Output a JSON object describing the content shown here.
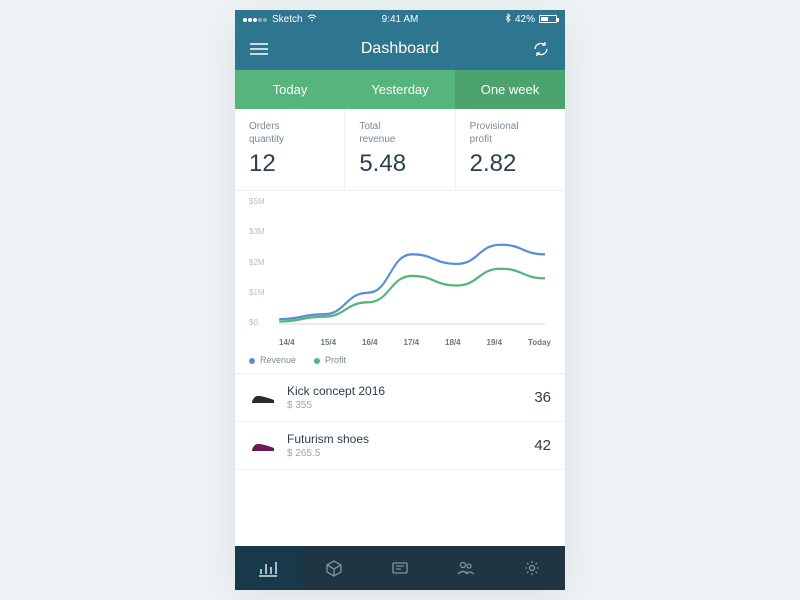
{
  "statusbar": {
    "carrier": "Sketch",
    "time": "9:41 AM",
    "battery_pct": "42%"
  },
  "header": {
    "title": "Dashboard"
  },
  "tabs": [
    {
      "label": "Today",
      "active": false
    },
    {
      "label": "Yesterday",
      "active": false
    },
    {
      "label": "One week",
      "active": true
    }
  ],
  "stats": [
    {
      "label": "Orders\nquantity",
      "value": "12"
    },
    {
      "label": "Total\nrevenue",
      "value": "5.48"
    },
    {
      "label": "Provisional\nprofit",
      "value": "2.82"
    }
  ],
  "chart_data": {
    "type": "line",
    "title": "",
    "xlabel": "",
    "ylabel": "",
    "x": [
      "14/4",
      "15/4",
      "16/4",
      "17/4",
      "18/4",
      "19/4",
      "Today"
    ],
    "y_ticks": [
      "$5M",
      "$3M",
      "$2M",
      "$1M",
      "$0"
    ],
    "ylim": [
      0,
      5
    ],
    "series": [
      {
        "name": "Revenue",
        "color": "#5a8fd6",
        "values": [
          0.2,
          0.4,
          1.3,
          2.9,
          2.5,
          3.3,
          2.9
        ]
      },
      {
        "name": "Profit",
        "color": "#55b57a",
        "values": [
          0.1,
          0.3,
          0.9,
          2.0,
          1.6,
          2.3,
          1.9
        ]
      }
    ]
  },
  "legend": [
    {
      "label": "Revenue",
      "color": "#5a8fd6"
    },
    {
      "label": "Profit",
      "color": "#55b57a"
    }
  ],
  "products": [
    {
      "name": "Kick concept 2016",
      "price": "$ 355",
      "count": "36",
      "swatch": "#2b2b2b"
    },
    {
      "name": "Futurism shoes",
      "price": "$ 265.5",
      "count": "42",
      "swatch": "#6a1b5a"
    }
  ],
  "nav": {
    "items": [
      "analytics",
      "orders",
      "messages",
      "customers",
      "settings"
    ],
    "active": 0
  }
}
